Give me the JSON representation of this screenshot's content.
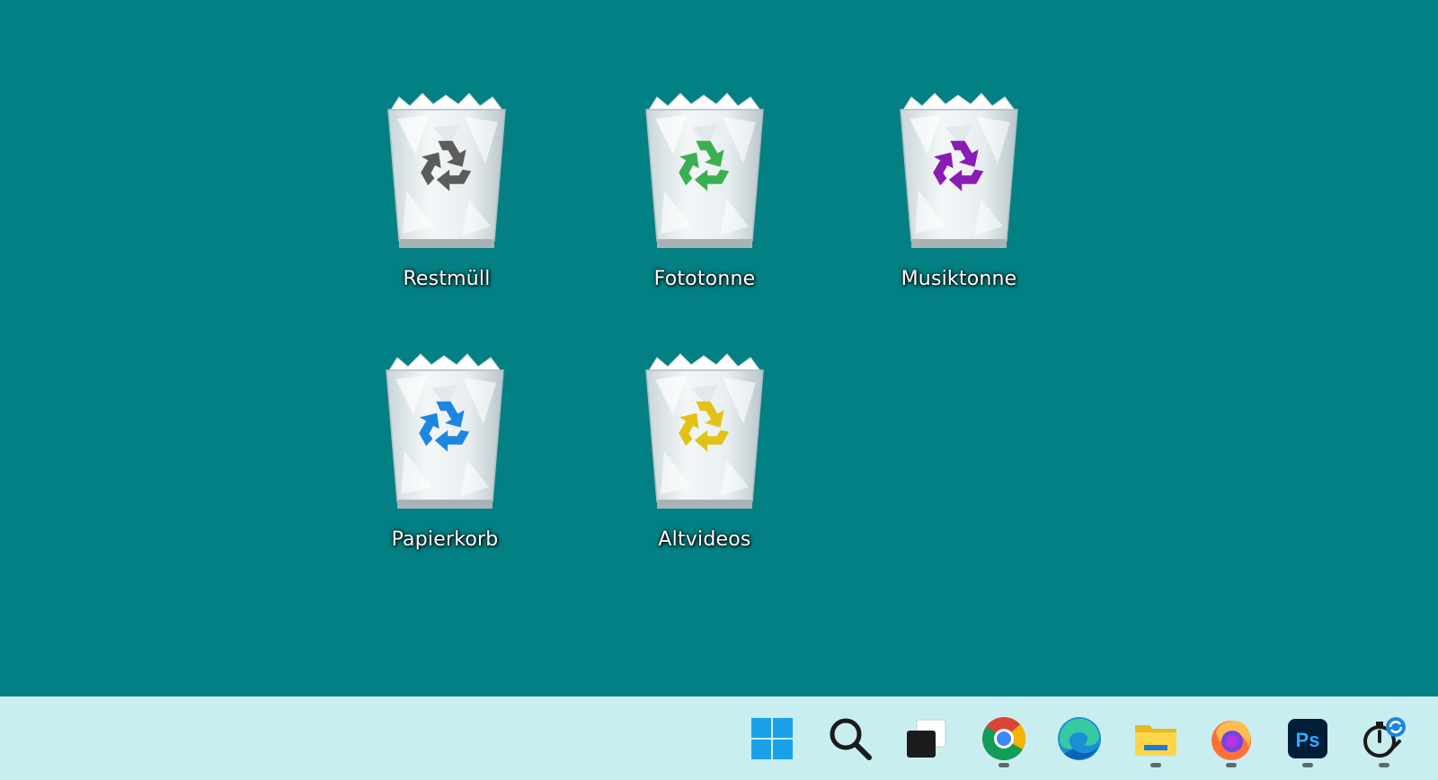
{
  "desktop": {
    "background": "#038083",
    "icons": [
      {
        "label": "Restmüll",
        "icon": "recycle-bin-gray-icon",
        "color": "#5c5c5c"
      },
      {
        "label": "Fototonne",
        "icon": "recycle-bin-green-icon",
        "color": "#3bb052"
      },
      {
        "label": "Musiktonne",
        "icon": "recycle-bin-purple-icon",
        "color": "#8a1bb4"
      },
      {
        "label": "Papierkorb",
        "icon": "recycle-bin-blue-icon",
        "color": "#1e86e0"
      },
      {
        "label": "Altvideos",
        "icon": "recycle-bin-yellow-icon",
        "color": "#e3c218"
      }
    ]
  },
  "taskbar": {
    "background": "#c9eef0",
    "items": [
      {
        "name": "start-button",
        "icon": "windows-logo-icon",
        "running": false
      },
      {
        "name": "search-button",
        "icon": "search-icon",
        "running": false
      },
      {
        "name": "task-view-button",
        "icon": "task-view-icon",
        "running": false
      },
      {
        "name": "chrome-button",
        "icon": "chrome-icon",
        "running": true
      },
      {
        "name": "edge-button",
        "icon": "edge-icon",
        "running": false
      },
      {
        "name": "file-explorer-button",
        "icon": "folder-icon",
        "running": true
      },
      {
        "name": "firefox-button",
        "icon": "firefox-icon",
        "running": true
      },
      {
        "name": "photoshop-button",
        "icon": "photoshop-icon",
        "running": true,
        "text": "Ps"
      },
      {
        "name": "sync-tool-button",
        "icon": "stopwatch-sync-icon",
        "running": true
      }
    ]
  }
}
